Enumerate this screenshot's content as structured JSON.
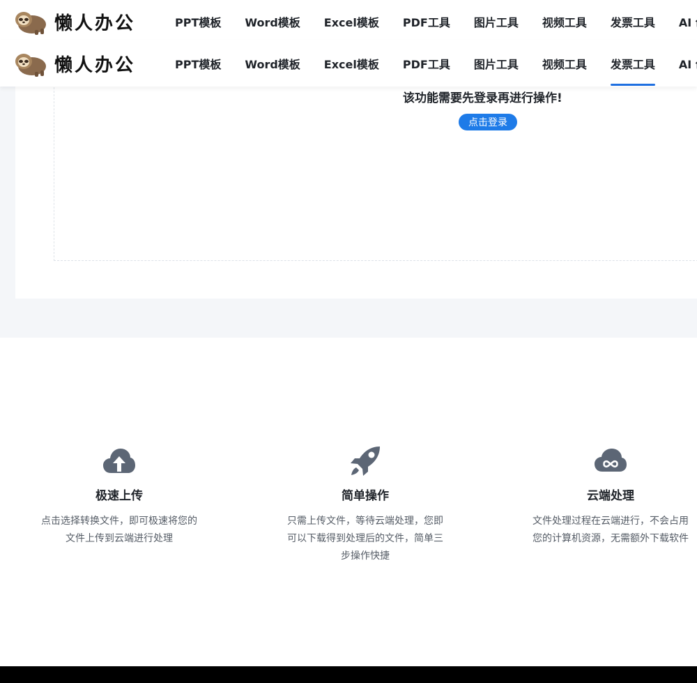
{
  "header": {
    "brand": "懒人办公",
    "nav": [
      "PPT模板",
      "Word模板",
      "Excel模板",
      "PDF工具",
      "图片工具",
      "视频工具",
      "发票工具",
      "AI 创作"
    ],
    "active_nav": "发票工具"
  },
  "workspace": {
    "login_message": "该功能需要先登录再进行操作!",
    "login_button": "点击登录"
  },
  "features": [
    {
      "icon": "cloud-upload-icon",
      "title": "极速上传",
      "desc": "点击选择转换文件，即可极速将您的文件上传到云端进行处理"
    },
    {
      "icon": "rocket-icon",
      "title": "简单操作",
      "desc": "只需上传文件，等待云端处理，您即可以下载得到处理后的文件，简单三步操作快捷"
    },
    {
      "icon": "cloud-infinity-icon",
      "title": "云端处理",
      "desc": "文件处理过程在云端进行，不会占用您的计算机资源，无需额外下载软件"
    }
  ],
  "colors": {
    "accent": "#1e7be8",
    "icon": "#5c6675",
    "panel_bg": "#f4f6f9",
    "footer": "#000000"
  }
}
